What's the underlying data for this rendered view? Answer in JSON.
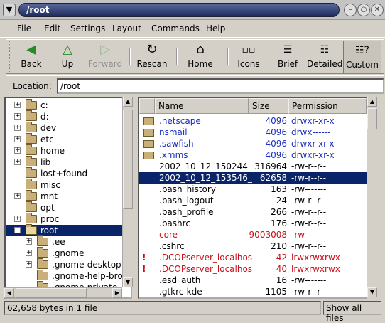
{
  "window": {
    "title": "/root"
  },
  "menu": [
    "File",
    "Edit",
    "Settings",
    "Layout",
    "Commands",
    "Help"
  ],
  "toolbar": [
    {
      "label": "Back",
      "icon": "back-arrow-icon",
      "enabled": true
    },
    {
      "label": "Up",
      "icon": "up-arrow-icon",
      "enabled": true
    },
    {
      "label": "Forward",
      "icon": "forward-arrow-icon",
      "enabled": false
    },
    {
      "label": "Rescan",
      "icon": "rescan-icon",
      "enabled": true
    },
    {
      "label": "Home",
      "icon": "home-icon",
      "enabled": true
    },
    {
      "label": "Icons",
      "icon": "icons-view-icon",
      "enabled": true
    },
    {
      "label": "Brief",
      "icon": "brief-view-icon",
      "enabled": true
    },
    {
      "label": "Detailed",
      "icon": "detailed-view-icon",
      "enabled": true
    },
    {
      "label": "Custom",
      "icon": "custom-view-icon",
      "enabled": true,
      "active": true
    }
  ],
  "location": {
    "label": "Location:",
    "value": "/root"
  },
  "tree": [
    {
      "name": "c:",
      "expander": "+",
      "level": 0
    },
    {
      "name": "d:",
      "expander": "+",
      "level": 0
    },
    {
      "name": "dev",
      "expander": "+",
      "level": 0
    },
    {
      "name": "etc",
      "expander": "+",
      "level": 0
    },
    {
      "name": "home",
      "expander": "+",
      "level": 0
    },
    {
      "name": "lib",
      "expander": "+",
      "level": 0
    },
    {
      "name": "lost+found",
      "expander": "",
      "level": 0
    },
    {
      "name": "misc",
      "expander": "",
      "level": 0
    },
    {
      "name": "mnt",
      "expander": "+",
      "level": 0
    },
    {
      "name": "opt",
      "expander": "",
      "level": 0
    },
    {
      "name": "proc",
      "expander": "+",
      "level": 0
    },
    {
      "name": "root",
      "expander": "−",
      "level": 0,
      "selected": true
    },
    {
      "name": ".ee",
      "expander": "+",
      "level": 1
    },
    {
      "name": ".gnome",
      "expander": "+",
      "level": 1
    },
    {
      "name": ".gnome-desktop",
      "expander": "+",
      "level": 1
    },
    {
      "name": ".gnome-help-brow",
      "expander": "",
      "level": 1
    },
    {
      "name": ".gnome-private",
      "expander": "",
      "level": 1
    }
  ],
  "columns": {
    "name": "Name",
    "size": "Size",
    "perm": "Permission"
  },
  "files": [
    {
      "name": ".netscape",
      "size": "4096",
      "perm": "drwxr-xr-x",
      "color": "blue",
      "folder": true
    },
    {
      "name": "nsmail",
      "size": "4096",
      "perm": "drwx------",
      "color": "blue",
      "folder": true
    },
    {
      "name": ".sawfish",
      "size": "4096",
      "perm": "drwxr-xr-x",
      "color": "blue",
      "folder": true
    },
    {
      "name": ".xmms",
      "size": "4096",
      "perm": "drwxr-xr-x",
      "color": "blue",
      "folder": true
    },
    {
      "name": "2002_10_12_150244_",
      "size": "316964",
      "perm": "-rw-r--r--",
      "color": "black"
    },
    {
      "name": "2002_10_12_153546_",
      "size": "62658",
      "perm": "-rw-r--r--",
      "color": "black",
      "selected": true
    },
    {
      "name": ".bash_history",
      "size": "163",
      "perm": "-rw-------",
      "color": "black"
    },
    {
      "name": ".bash_logout",
      "size": "24",
      "perm": "-rw-r--r--",
      "color": "black"
    },
    {
      "name": ".bash_profile",
      "size": "266",
      "perm": "-rw-r--r--",
      "color": "black"
    },
    {
      "name": ".bashrc",
      "size": "176",
      "perm": "-rw-r--r--",
      "color": "black"
    },
    {
      "name": "core",
      "size": "9003008",
      "perm": "-rw-------",
      "color": "red"
    },
    {
      "name": ".cshrc",
      "size": "210",
      "perm": "-rw-r--r--",
      "color": "black"
    },
    {
      "name": ".DCOPserver_localhos",
      "size": "42",
      "perm": "lrwxrwxrwx",
      "color": "red",
      "flag": "!"
    },
    {
      "name": ".DCOPserver_localhos",
      "size": "40",
      "perm": "lrwxrwxrwx",
      "color": "red",
      "flag": "!"
    },
    {
      "name": ".esd_auth",
      "size": "16",
      "perm": "-rw-------",
      "color": "black"
    },
    {
      "name": ".gtkrc-kde",
      "size": "1105",
      "perm": "-rw-r--r--",
      "color": "black"
    }
  ],
  "status": {
    "left": "62,658 bytes in 1 file",
    "right": "Show all files"
  }
}
